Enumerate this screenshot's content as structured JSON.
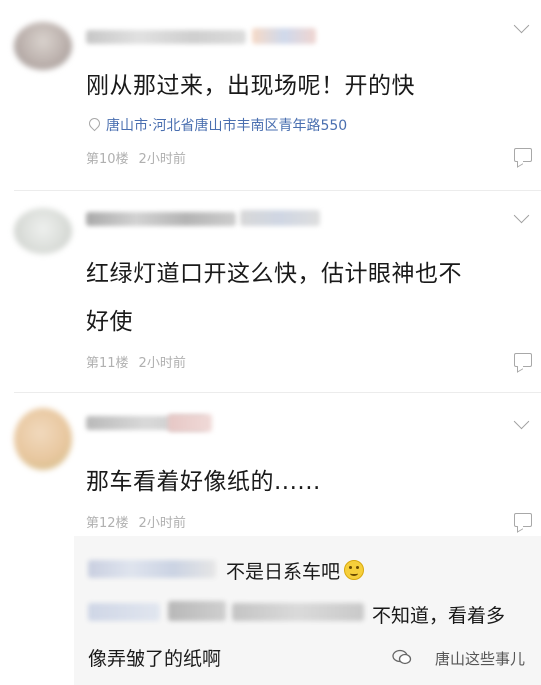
{
  "comments": [
    {
      "text": "刚从那过来，出现场呢！开的快",
      "location": "唐山市·河北省唐山市丰南区青年路550",
      "floor": "第10楼",
      "time": "2小时前"
    },
    {
      "text_line1": "红绿灯道口开这么快，估计眼神也不",
      "text_line2": "好使",
      "floor": "第11楼",
      "time": "2小时前"
    },
    {
      "text": "那车看着好像纸的......",
      "floor": "第12楼",
      "time": "2小时前"
    }
  ],
  "replies": [
    {
      "text": "不是日系车吧"
    },
    {
      "text_line1": "不知道，看着多",
      "text_line2": "像弄皱了的纸啊"
    }
  ],
  "watermark": "唐山这些事儿",
  "icons": {
    "chevron": "chevron-down-icon",
    "reply": "comment-reply-icon",
    "location": "location-pin-icon",
    "emoji": "grimace-emoji-icon",
    "watermark": "wechat-logo-icon"
  }
}
